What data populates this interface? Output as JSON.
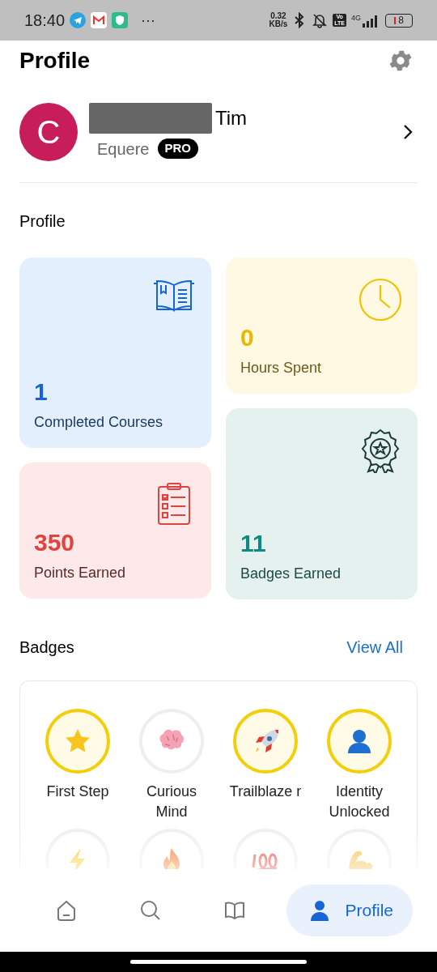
{
  "status_bar": {
    "time": "18:40",
    "more": "···",
    "speed_value": "0.32",
    "speed_unit": "KB/s",
    "volte_top": "Vo",
    "volte_bottom": "LTE",
    "network": "4G",
    "battery": "8"
  },
  "header": {
    "title": "Profile"
  },
  "user": {
    "avatar_letter": "C",
    "name_redacted": true,
    "name": "Tim",
    "subtitle": "Equere",
    "badge": "PRO"
  },
  "section_title": "Profile",
  "stats": [
    {
      "kind": "courses",
      "value": "1",
      "label": "Completed Courses"
    },
    {
      "kind": "points",
      "value": "350",
      "label": "Points Earned"
    },
    {
      "kind": "hours",
      "value": "0",
      "label": "Hours Spent"
    },
    {
      "kind": "badges",
      "value": "11",
      "label": "Badges Earned"
    }
  ],
  "badges_section": {
    "title": "Badges",
    "link": "View All"
  },
  "badges": [
    {
      "kind": "star",
      "label": "First Step",
      "earned": true
    },
    {
      "kind": "brain",
      "label": "Curious Mind",
      "earned": false
    },
    {
      "kind": "rocket",
      "label": "Trailblaze r",
      "earned": true
    },
    {
      "kind": "person",
      "label": "Identity Unlocked",
      "earned": true
    },
    {
      "kind": "bolt",
      "earned": false
    },
    {
      "kind": "fire",
      "earned": false
    },
    {
      "kind": "hundred",
      "earned": false
    },
    {
      "kind": "muscle",
      "earned": false
    }
  ],
  "nav": [
    {
      "kind": "home",
      "selected": false
    },
    {
      "kind": "search",
      "selected": false
    },
    {
      "kind": "book",
      "selected": false
    },
    {
      "kind": "profile",
      "label": "Profile",
      "selected": true
    }
  ]
}
